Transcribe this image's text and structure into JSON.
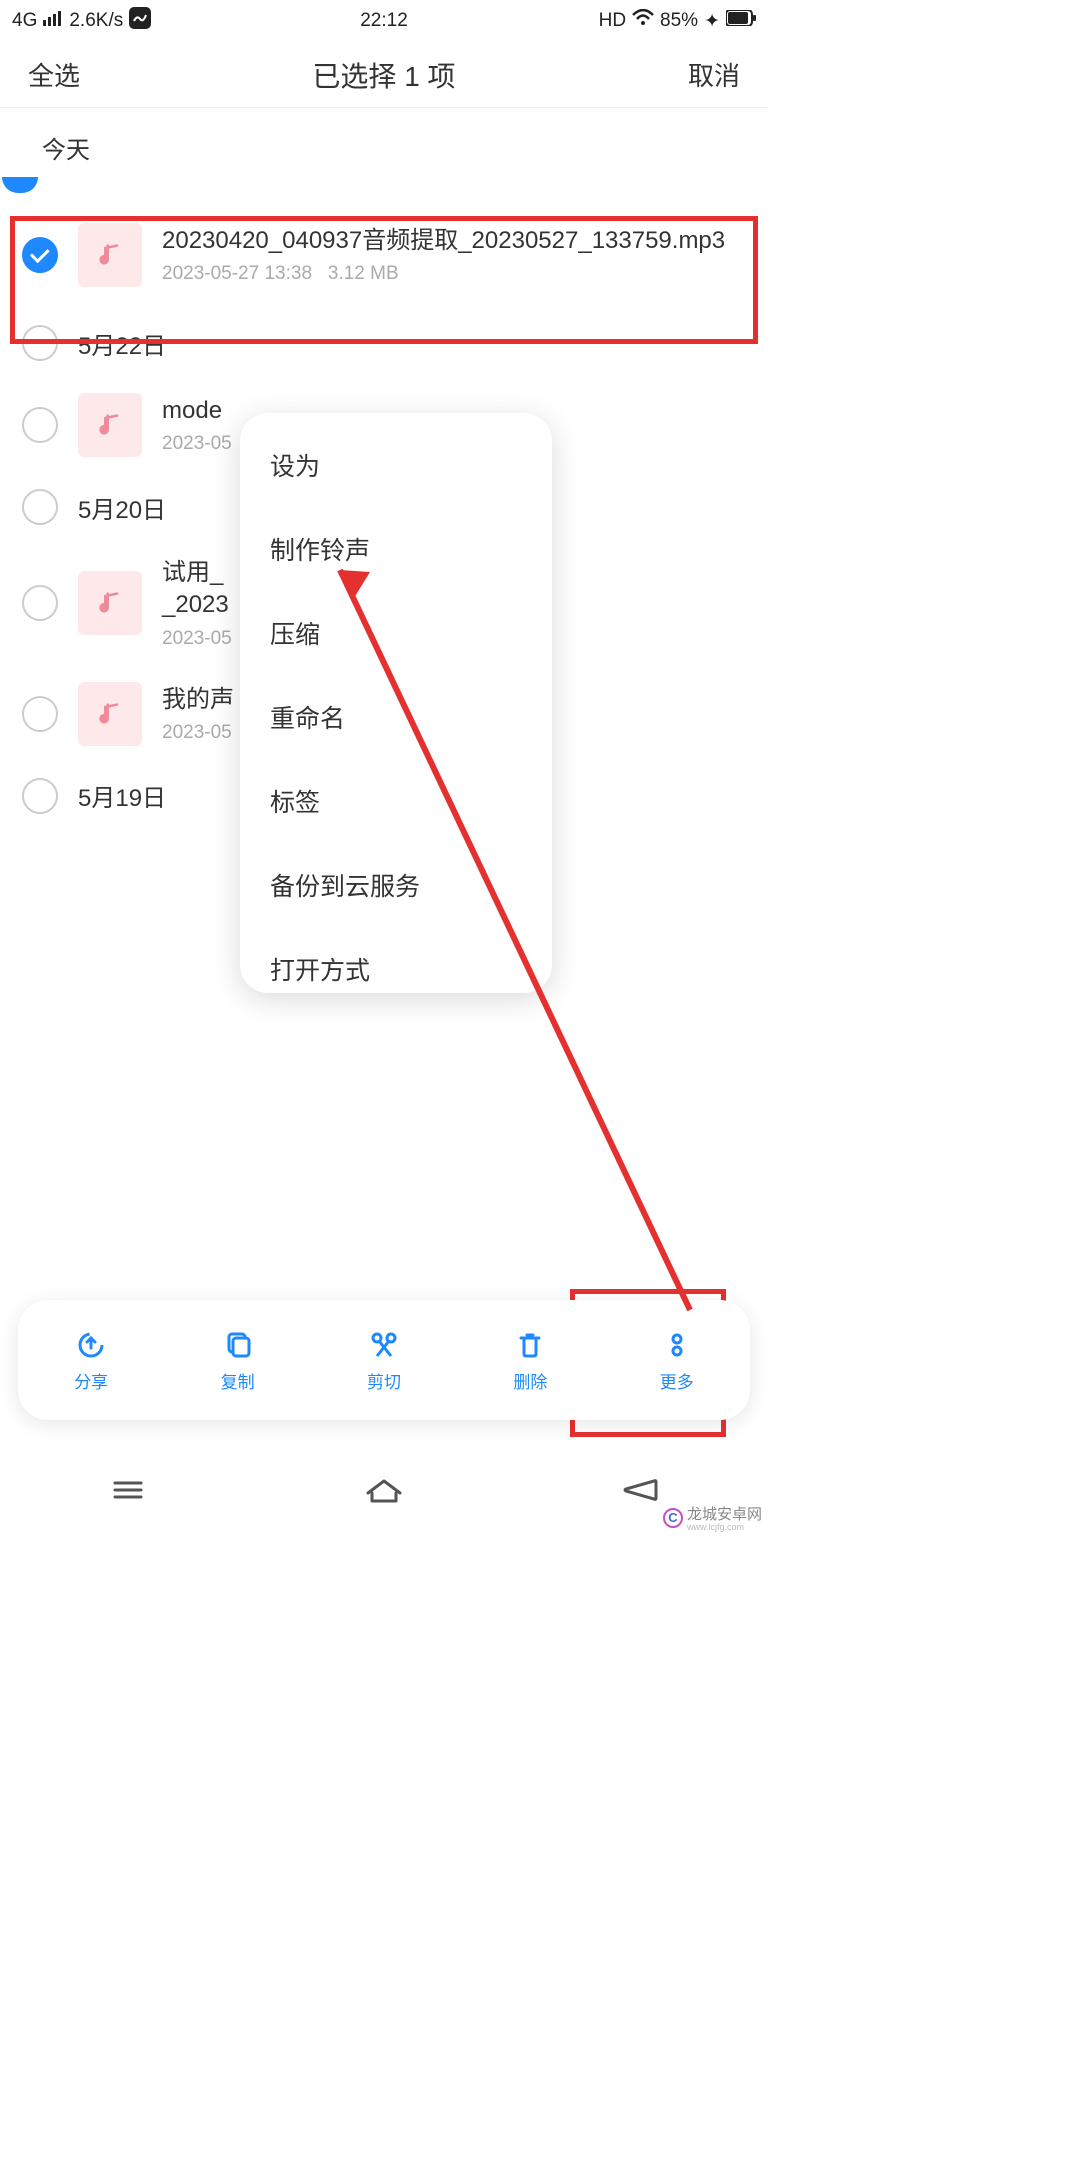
{
  "status": {
    "network": "4G",
    "speed": "2.6K/s",
    "time": "22:12",
    "hd": "HD",
    "battery": "85%"
  },
  "header": {
    "select_all": "全选",
    "title": "已选择 1 项",
    "cancel": "取消"
  },
  "section_today": "今天",
  "selected_file": {
    "name": "20230420_040937音频提取_20230527_133759.mp3",
    "date": "2023-05-27 13:38",
    "size": "3.12 MB"
  },
  "groups": [
    {
      "date": "5月22日",
      "files": [
        {
          "name_prefix": "mode",
          "meta_prefix": "2023-05"
        }
      ]
    },
    {
      "date": "5月20日",
      "files": [
        {
          "name_prefix": "试用_\n_2023",
          "meta_prefix": "2023-05"
        },
        {
          "name_prefix": "我的声",
          "meta_prefix": "2023-05"
        }
      ]
    },
    {
      "date": "5月19日",
      "files": []
    }
  ],
  "popup": {
    "items": [
      "设为",
      "制作铃声",
      "压缩",
      "重命名",
      "标签",
      "备份到云服务",
      "打开方式"
    ]
  },
  "actions": {
    "share": "分享",
    "copy": "复制",
    "cut": "剪切",
    "delete": "删除",
    "more": "更多"
  },
  "watermark": {
    "text": "龙城安卓网",
    "sub": "www.lcjfg.com"
  }
}
